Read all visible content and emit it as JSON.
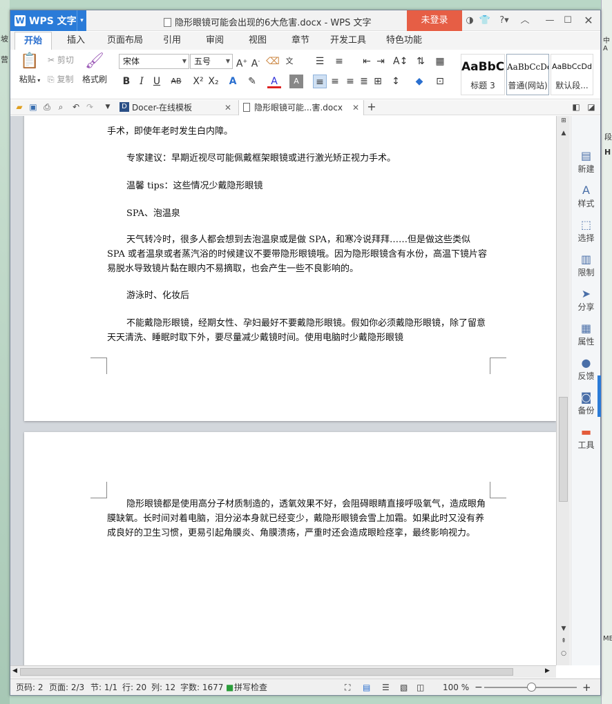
{
  "background": {
    "left_labels": [
      "坡",
      "营"
    ],
    "right_labels": [
      "中A",
      "段",
      "H",
      "MB"
    ]
  },
  "titlebar": {
    "app_name": "WPS 文字",
    "doc_title": "隐形眼镜可能会出现的6大危害.docx - WPS 文字",
    "login": "未登录",
    "icons": [
      "settings-icon",
      "skin-icon",
      "help-icon",
      "collapse-icon",
      "minimize-icon",
      "maximize-icon",
      "close-icon"
    ]
  },
  "ribbon_tabs": [
    "开始",
    "插入",
    "页面布局",
    "引用",
    "审阅",
    "视图",
    "章节",
    "开发工具",
    "特色功能"
  ],
  "ribbon": {
    "paste": "粘贴",
    "cut": "剪切",
    "copy": "复制",
    "format_painter": "格式刷",
    "font_name": "宋体",
    "font_size": "五号",
    "styles": [
      {
        "sample": "AaBbC",
        "label": "标题 3"
      },
      {
        "sample": "AaBbCcDd",
        "label": "普通(网站)"
      },
      {
        "sample": "AaBbCcDd",
        "label": "默认段..."
      }
    ]
  },
  "doc_tabs": [
    {
      "label": "Docer-在线模板"
    },
    {
      "label": "隐形眼镜可能...害.docx"
    }
  ],
  "document": {
    "page1": [
      "手术，即使年老时发生白内障。",
      "专家建议：早期近视尽可能佩戴框架眼镜或进行激光矫正视力手术。",
      "温馨 tips：这些情况少戴隐形眼镜",
      "SPA、泡温泉",
      "天气转冷时，很多人都会想到去泡温泉或是做 SPA，和寒冷说拜拜……但是做这些类似 SPA 或者温泉或者蒸汽浴的时候建议不要带隐形眼镜哦。因为隐形眼镜含有水份，高温下镜片容易脱水导致镜片黏在眼内不易摘取，也会产生一些不良影响的。",
      "游泳时、化妆后",
      "不能戴隐形眼镜，经期女性、孕妇最好不要戴隐形眼镜。假如你必须戴隐形眼镜，除了留意天天清洗、睡眠时取下外，要尽量减少戴镜时间。使用电脑时少戴隐形眼镜"
    ],
    "page2": [
      "隐形眼镜都是使用高分子材质制造的，透氧效果不好，会阻碍眼睛直接呼吸氧气，造成眼角膜缺氧。长时间对着电脑，泪分泌本身就已经变少，戴隐形眼镜会雪上加霜。如果此时又没有养成良好的卫生习惯，更易引起角膜炎、角膜溃疡，严重时还会造成眼睑痉挛，最终影响视力。"
    ]
  },
  "side_panel": [
    "新建",
    "样式",
    "选择",
    "限制",
    "分享",
    "属性",
    "反馈",
    "备份",
    "工具"
  ],
  "statusbar": {
    "page": "页码: 2",
    "pages": "页面: 2/3",
    "section": "节: 1/1",
    "row": "行: 20",
    "col": "列: 12",
    "words": "字数: 1677",
    "spell": "拼写检查",
    "zoom": "100 %"
  },
  "colors": {
    "accent": "#2a7bd8",
    "login": "#e65e45"
  }
}
